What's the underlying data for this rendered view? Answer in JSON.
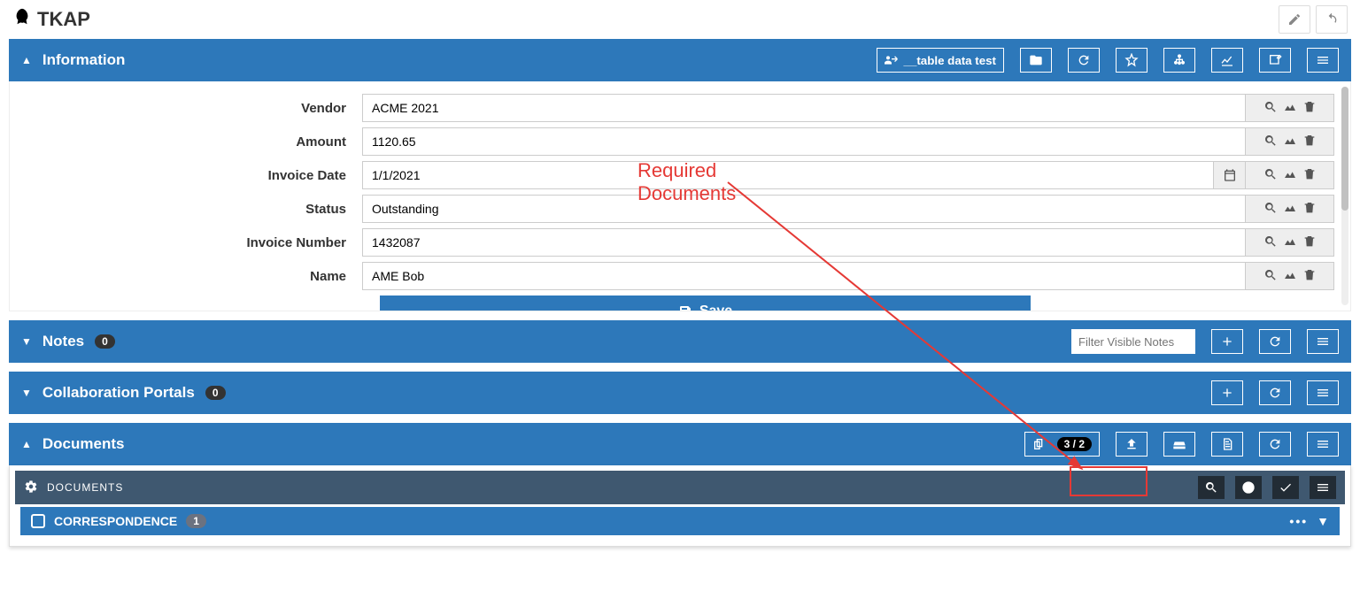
{
  "app": {
    "name": "TKAP"
  },
  "info_panel": {
    "title": "Information",
    "actions": {
      "table_data": "__table data test"
    },
    "fields": [
      {
        "label": "Vendor",
        "value": "ACME 2021",
        "calendar": false
      },
      {
        "label": "Amount",
        "value": "1120.65",
        "calendar": false
      },
      {
        "label": "Invoice Date",
        "value": "1/1/2021",
        "calendar": true
      },
      {
        "label": "Status",
        "value": "Outstanding",
        "calendar": false
      },
      {
        "label": "Invoice Number",
        "value": "1432087",
        "calendar": false
      },
      {
        "label": "Name",
        "value": "AME Bob",
        "calendar": false
      }
    ],
    "save_label": "Save"
  },
  "notes_panel": {
    "title": "Notes",
    "count": "0",
    "filter_placeholder": "Filter Visible Notes"
  },
  "collab_panel": {
    "title": "Collaboration Portals",
    "count": "0"
  },
  "docs_panel": {
    "title": "Documents",
    "required_docs": "3 / 2",
    "sub_title": "Documents",
    "row": {
      "name": "CORRESPONDENCE",
      "count": "1"
    }
  },
  "annotation": {
    "label": "Required Documents"
  }
}
